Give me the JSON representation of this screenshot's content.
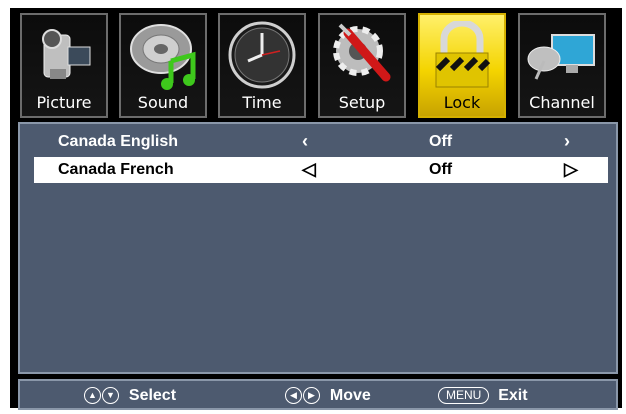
{
  "tabs": [
    {
      "label": "Picture",
      "icon": "camcorder-icon",
      "active": false
    },
    {
      "label": "Sound",
      "icon": "speaker-music-icon",
      "active": false
    },
    {
      "label": "Time",
      "icon": "clock-icon",
      "active": false
    },
    {
      "label": "Setup",
      "icon": "gear-screwdriver-icon",
      "active": false
    },
    {
      "label": "Lock",
      "icon": "padlock-icon",
      "active": true
    },
    {
      "label": "Channel",
      "icon": "satellite-tv-icon",
      "active": false
    }
  ],
  "rows": [
    {
      "label": "Canada English",
      "value": "Off",
      "left_arrow": "‹",
      "right_arrow": "›",
      "selected": false
    },
    {
      "label": "Canada French",
      "value": "Off",
      "left_arrow": "◁",
      "right_arrow": "▷",
      "selected": true
    }
  ],
  "footer": {
    "select_label": "Select",
    "move_label": "Move",
    "menu_key": "MENU",
    "exit_label": "Exit"
  },
  "colors": {
    "panel": "#4d5a6f",
    "active_tab": "#f4d400",
    "selected_row": "#ffffff"
  }
}
